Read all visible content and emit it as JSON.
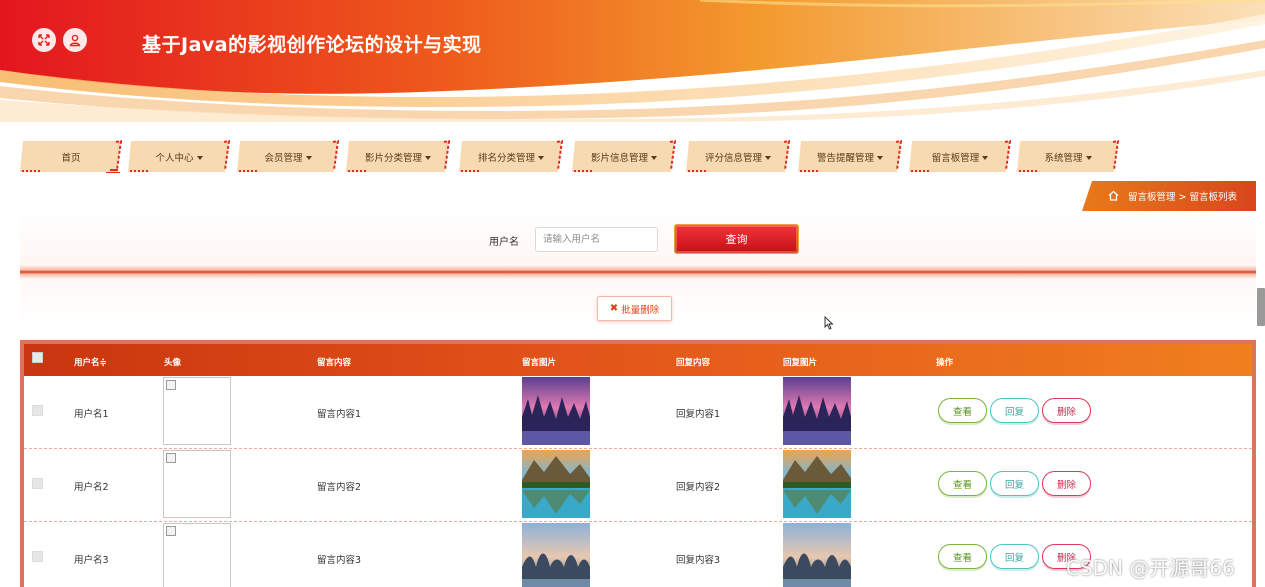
{
  "header": {
    "title": "基于Java的影视创作论坛的设计与实现",
    "buttons": [
      "fullscreen-icon",
      "user-icon"
    ]
  },
  "nav": {
    "items": [
      {
        "label": "首页",
        "dropdown": false
      },
      {
        "label": "个人中心",
        "dropdown": true
      },
      {
        "label": "会员管理",
        "dropdown": true
      },
      {
        "label": "影片分类管理",
        "dropdown": true
      },
      {
        "label": "排名分类管理",
        "dropdown": true
      },
      {
        "label": "影片信息管理",
        "dropdown": true
      },
      {
        "label": "评分信息管理",
        "dropdown": true
      },
      {
        "label": "警告提醒管理",
        "dropdown": true
      },
      {
        "label": "留言板管理",
        "dropdown": true
      },
      {
        "label": "系统管理",
        "dropdown": true
      }
    ]
  },
  "breadcrumb": {
    "text": "留言板管理 > 留言板列表",
    "icon": "home-icon"
  },
  "search": {
    "label": "用户名",
    "placeholder": "请输入用户名",
    "value": "",
    "button": "查询"
  },
  "batch_delete": {
    "label": "批量删除",
    "icon": "x-icon"
  },
  "table": {
    "columns": [
      "用户名≑",
      "头像",
      "留言内容",
      "留言图片",
      "回复内容",
      "回复图片",
      "操作"
    ],
    "rows": [
      {
        "username": "用户名1",
        "content": "留言内容1",
        "reply": "回复内容1",
        "image": "purple-sky-forest"
      },
      {
        "username": "用户名2",
        "content": "留言内容2",
        "reply": "回复内容2",
        "image": "mountain-lake"
      },
      {
        "username": "用户名3",
        "content": "留言内容3",
        "reply": "回复内容3",
        "image": "karst-hills"
      }
    ],
    "actions": {
      "view": "查看",
      "reply": "回复",
      "delete": "删除"
    }
  },
  "watermark": "CSDN @开源哥66",
  "colors": {
    "header_red": "#e02020",
    "header_orange": "#f08a1e",
    "nav_bg": "#f7d9b2",
    "nav_edge": "#e02b20",
    "primary_red": "#d9421c",
    "table_head": "#e2541a"
  }
}
